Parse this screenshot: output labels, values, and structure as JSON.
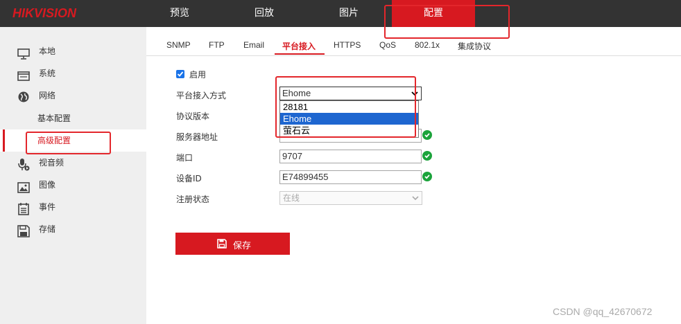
{
  "header": {
    "logo": "HIKVISION",
    "nav": [
      "预览",
      "回放",
      "图片",
      "配置"
    ],
    "active_nav": "配置"
  },
  "sidebar": {
    "items": [
      {
        "label": "本地",
        "icon": "monitor-icon"
      },
      {
        "label": "系统",
        "icon": "window-icon"
      },
      {
        "label": "网络",
        "icon": "globe-icon"
      },
      {
        "label": "视音频",
        "icon": "microphone-icon"
      },
      {
        "label": "图像",
        "icon": "image-icon"
      },
      {
        "label": "事件",
        "icon": "list-icon"
      },
      {
        "label": "存储",
        "icon": "floppy-icon"
      }
    ],
    "network_sub": [
      "基本配置",
      "高级配置"
    ],
    "active_sub": "高级配置"
  },
  "tabs": [
    "SNMP",
    "FTP",
    "Email",
    "平台接入",
    "HTTPS",
    "QoS",
    "802.1x",
    "集成协议"
  ],
  "active_tab": "平台接入",
  "form": {
    "enable_label": "启用",
    "enabled": true,
    "access_mode_label": "平台接入方式",
    "access_mode_value": "Ehome",
    "access_mode_options": [
      "28181",
      "Ehome",
      "萤石云"
    ],
    "protocol_version_label": "协议版本",
    "server_address_label": "服务器地址",
    "port_label": "端口",
    "port_value": "9707",
    "device_id_label": "设备ID",
    "device_id_value": "E74899455",
    "register_status_label": "注册状态",
    "register_status_value": "在线"
  },
  "save_button": "保存",
  "watermark": "CSDN @qq_42670672",
  "colors": {
    "accent": "#d71920",
    "topbar": "#333333",
    "sidebar": "#efefef",
    "ok": "#1ba33b",
    "selection": "#1e66d0"
  }
}
